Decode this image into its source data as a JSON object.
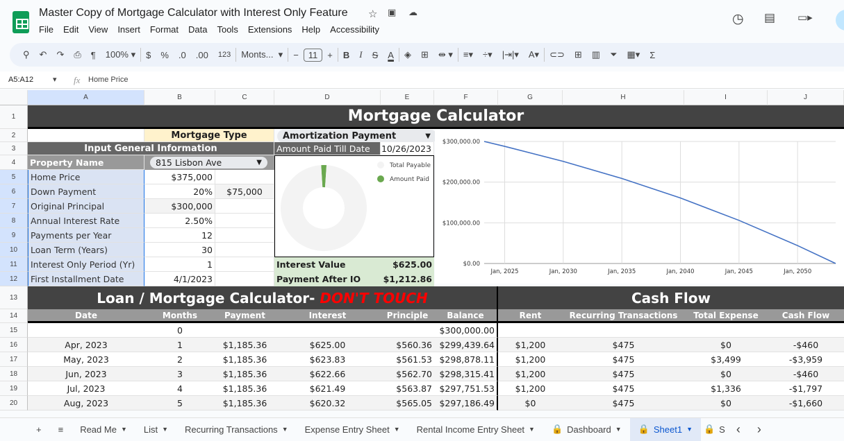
{
  "app": {
    "title": "Master Copy of Mortgage Calculator with Interest Only Feature",
    "menu": [
      "File",
      "Edit",
      "View",
      "Insert",
      "Format",
      "Data",
      "Tools",
      "Extensions",
      "Help",
      "Accessibility"
    ]
  },
  "toolbar": {
    "zoom": "100%",
    "currency": "$",
    "percent": "%",
    "dec_dec": ".0",
    "inc_dec": ".00",
    "format_123": "123",
    "font": "Monts...",
    "font_size": "11"
  },
  "formula_bar": {
    "name_box": "A5:A12",
    "fx": "fx",
    "content": "Home Price"
  },
  "columns": [
    "A",
    "B",
    "C",
    "D",
    "E",
    "F",
    "G",
    "H",
    "I",
    "J"
  ],
  "rows": [
    "1",
    "2",
    "3",
    "4",
    "5",
    "6",
    "7",
    "8",
    "9",
    "10",
    "11",
    "12",
    "13",
    "14",
    "15",
    "16",
    "17",
    "18",
    "19",
    "20"
  ],
  "sheet": {
    "title": "Mortgage Calculator",
    "mortgage_type_label": "Mortgage Type",
    "mortgage_type_value": "Amortization Payment",
    "input_header": "Input General Information",
    "amount_paid_label": "Amount Paid Till Date",
    "amount_paid_date": "10/26/2023",
    "property_label": "Property Name",
    "property_value": "815 Lisbon Ave",
    "inputs": [
      {
        "label": "Home Price",
        "value": "$375,000",
        "extra": ""
      },
      {
        "label": "Down Payment",
        "value": "20%",
        "extra": "$75,000"
      },
      {
        "label": "Original Principal",
        "value": "$300,000",
        "extra": ""
      },
      {
        "label": "Annual Interest Rate",
        "value": "2.50%",
        "extra": ""
      },
      {
        "label": "Payments per Year",
        "value": "12",
        "extra": ""
      },
      {
        "label": "Loan Term (Years)",
        "value": "30",
        "extra": ""
      },
      {
        "label": "Interest Only Period (Yr)",
        "value": "1",
        "extra": ""
      },
      {
        "label": "First Installment Date",
        "value": "4/1/2023",
        "extra": ""
      }
    ],
    "interest_value_label": "Interest Value",
    "interest_value": "$625.00",
    "payment_after_io_label": "Payment After IO",
    "payment_after_io": "$1,212.86",
    "loan_title": "Loan / Mortgage Calculator-",
    "loan_title_warning": "DON'T TOUCH",
    "cashflow_title": "Cash Flow",
    "table_headers": [
      "Date",
      "Months",
      "Payment",
      "Interest",
      "Principle",
      "Balance",
      "Rent",
      "Recurring Transactions",
      "Total Expense",
      "Cash Flow"
    ],
    "table_rows": [
      [
        "",
        "0",
        "",
        "",
        "",
        "$300,000.00",
        "",
        "",
        "",
        ""
      ],
      [
        "Apr, 2023",
        "1",
        "$1,185.36",
        "$625.00",
        "$560.36",
        "$299,439.64",
        "$1,200",
        "$475",
        "$0",
        "-$460"
      ],
      [
        "May, 2023",
        "2",
        "$1,185.36",
        "$623.83",
        "$561.53",
        "$298,878.11",
        "$1,200",
        "$475",
        "$3,499",
        "-$3,959"
      ],
      [
        "Jun, 2023",
        "3",
        "$1,185.36",
        "$622.66",
        "$562.70",
        "$298,315.41",
        "$1,200",
        "$475",
        "$0",
        "-$460"
      ],
      [
        "Jul, 2023",
        "4",
        "$1,185.36",
        "$621.49",
        "$563.87",
        "$297,751.53",
        "$1,200",
        "$475",
        "$1,336",
        "-$1,797"
      ],
      [
        "Aug, 2023",
        "5",
        "$1,185.36",
        "$620.32",
        "$565.05",
        "$297,186.49",
        "$0",
        "$475",
        "$0",
        "-$1,660"
      ]
    ]
  },
  "chart_data": [
    {
      "type": "pie",
      "donut": true,
      "legend": "right",
      "series": [
        {
          "name": "Total Payable",
          "value": 0.98,
          "color": "#f3f3f3"
        },
        {
          "name": "Amount Paid",
          "value": 0.02,
          "color": "#6aa84f"
        }
      ]
    },
    {
      "type": "line",
      "x_type": "date",
      "ylim": [
        0,
        300000
      ],
      "yticks": [
        "$0.00",
        "$100,000.00",
        "$200,000.00",
        "$300,000.00"
      ],
      "ytick_values": [
        0,
        100000,
        200000,
        300000
      ],
      "xticks": [
        "Jan, 2025",
        "Jan, 2030",
        "Jan, 2035",
        "Jan, 2040",
        "Jan, 2045",
        "Jan, 2050"
      ],
      "xtick_values": [
        2025,
        2030,
        2035,
        2040,
        2045,
        2050
      ],
      "xlim": [
        2023.25,
        2053.25
      ],
      "grid": true,
      "color": "#4472c4",
      "x": [
        2023.25,
        2025,
        2030,
        2035,
        2040,
        2045,
        2050,
        2053.25
      ],
      "y": [
        300000,
        288000,
        251000,
        209000,
        161000,
        106000,
        44000,
        0
      ]
    }
  ],
  "tabs": [
    "Read Me",
    "List",
    "Recurring Transactions",
    "Expense Entry Sheet",
    "Rental Income Entry Sheet",
    "Dashboard",
    "Sheet1",
    "S"
  ],
  "active_tab": "Sheet1"
}
